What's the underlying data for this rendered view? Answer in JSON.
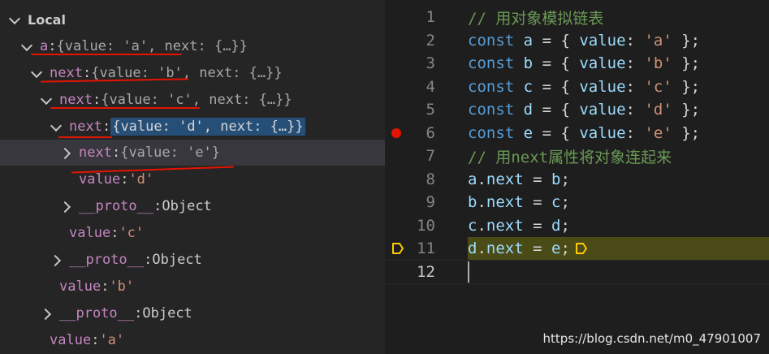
{
  "variables": {
    "section_title": "Local",
    "rows": [
      {
        "name": "a",
        "preview": "{value: 'a', next: {…}}"
      },
      {
        "name": "next",
        "preview": "{value: 'b', next: {…}}"
      },
      {
        "name": "next",
        "preview": "{value: 'c', next: {…}}"
      },
      {
        "name": "next",
        "preview": "{value: 'd', next: {…}}"
      },
      {
        "name": "next",
        "preview": "{value: 'e'}"
      },
      {
        "name": "value",
        "preview": "'d'"
      },
      {
        "name": "__proto__",
        "preview": "Object"
      },
      {
        "name": "value",
        "preview": "'c'"
      },
      {
        "name": "__proto__",
        "preview": "Object"
      },
      {
        "name": "value",
        "preview": "'b'"
      },
      {
        "name": "__proto__",
        "preview": "Object"
      },
      {
        "name": "value",
        "preview": "'a'"
      }
    ]
  },
  "editor": {
    "line_numbers": [
      "1",
      "2",
      "3",
      "4",
      "5",
      "6",
      "7",
      "8",
      "9",
      "10",
      "11",
      "12"
    ],
    "line1_comment": "// 用对象模拟链表",
    "consts": [
      {
        "kw": "const",
        "id": "a",
        "open": "= {",
        "prop": "value",
        "colon": ":",
        "val": "'a'",
        "close": "};"
      },
      {
        "kw": "const",
        "id": "b",
        "open": "= {",
        "prop": "value",
        "colon": ":",
        "val": "'b'",
        "close": "};"
      },
      {
        "kw": "const",
        "id": "c",
        "open": "= {",
        "prop": "value",
        "colon": ":",
        "val": "'c'",
        "close": "};"
      },
      {
        "kw": "const",
        "id": "d",
        "open": "= {",
        "prop": "value",
        "colon": ":",
        "val": "'d'",
        "close": "};"
      },
      {
        "kw": "const",
        "id": "e",
        "open": "= {",
        "prop": "value",
        "colon": ":",
        "val": "'e'",
        "close": "};"
      }
    ],
    "line7_comment": "// 用next属性将对象连起来",
    "assigns": [
      {
        "lhs": "a",
        "dot": ".",
        "prop": "next",
        "eq": "=",
        "rhs": "b",
        "semi": ";"
      },
      {
        "lhs": "b",
        "dot": ".",
        "prop": "next",
        "eq": "=",
        "rhs": "c",
        "semi": ";"
      },
      {
        "lhs": "c",
        "dot": ".",
        "prop": "next",
        "eq": "=",
        "rhs": "d",
        "semi": ";"
      },
      {
        "lhs": "d",
        "dot": ".",
        "prop": "next",
        "eq": "=",
        "rhs": "e",
        "semi": ";"
      }
    ],
    "breakpoint_line": 6,
    "current_line": 11
  },
  "watermark": "https://blog.csdn.net/m0_47901007",
  "colors": {
    "breakpoint": "#e51400",
    "current_arrow": "#ffcc00",
    "highlight_line": "#4b4b18",
    "underline": "#e51400"
  }
}
